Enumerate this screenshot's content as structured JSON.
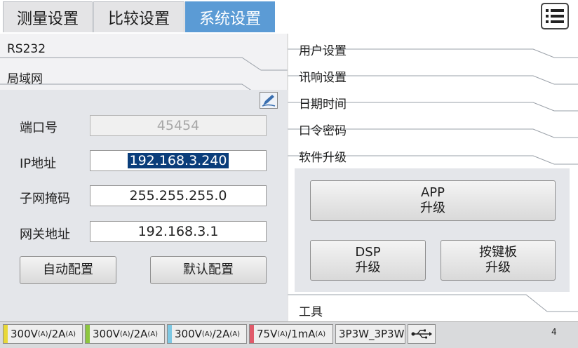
{
  "tabs": [
    {
      "label": "测量设置",
      "active": false
    },
    {
      "label": "比较设置",
      "active": false
    },
    {
      "label": "系统设置",
      "active": true
    }
  ],
  "left_sections": {
    "rs232": "RS232",
    "lan": "局域网"
  },
  "lan_form": {
    "port_label": "端口号",
    "port_value": "45454",
    "ip_label": "IP地址",
    "ip_value": "192.168.3.240",
    "mask_label": "子网掩码",
    "mask_value": "255.255.255.0",
    "gateway_label": "网关地址",
    "gateway_value": "192.168.3.1",
    "auto_config": "自动配置",
    "default_config": "默认配置"
  },
  "right_menu": {
    "user": "用户设置",
    "beep": "讯响设置",
    "datetime": "日期时间",
    "password": "口令密码",
    "firmware": "软件升级",
    "tools": "工具"
  },
  "upgrade": {
    "app_line1": "APP",
    "app_line2": "升级",
    "dsp_line1": "DSP",
    "dsp_line2": "升级",
    "keypad_line1": "按键板",
    "keypad_line2": "升级"
  },
  "status": {
    "ch1": {
      "v": "300V",
      "vu": "(A)",
      "a": "/2A",
      "au": "(A)",
      "color": "#e8d838"
    },
    "ch2": {
      "v": "300V",
      "vu": "(A)",
      "a": "/2A",
      "au": "(A)",
      "color": "#8cc63f"
    },
    "ch3": {
      "v": "300V",
      "vu": "(A)",
      "a": "/2A",
      "au": "(A)",
      "color": "#7ec8e3"
    },
    "ch4": {
      "v": "75V",
      "vu": "(A)",
      "a": "/1mA",
      "au": "(A)",
      "color": "#e05a6a"
    },
    "wiring": "3P3W_3P3W",
    "page": "4"
  },
  "icons": {
    "menu": "menu-icon",
    "edit": "edit-icon",
    "usb": "usb-icon"
  }
}
